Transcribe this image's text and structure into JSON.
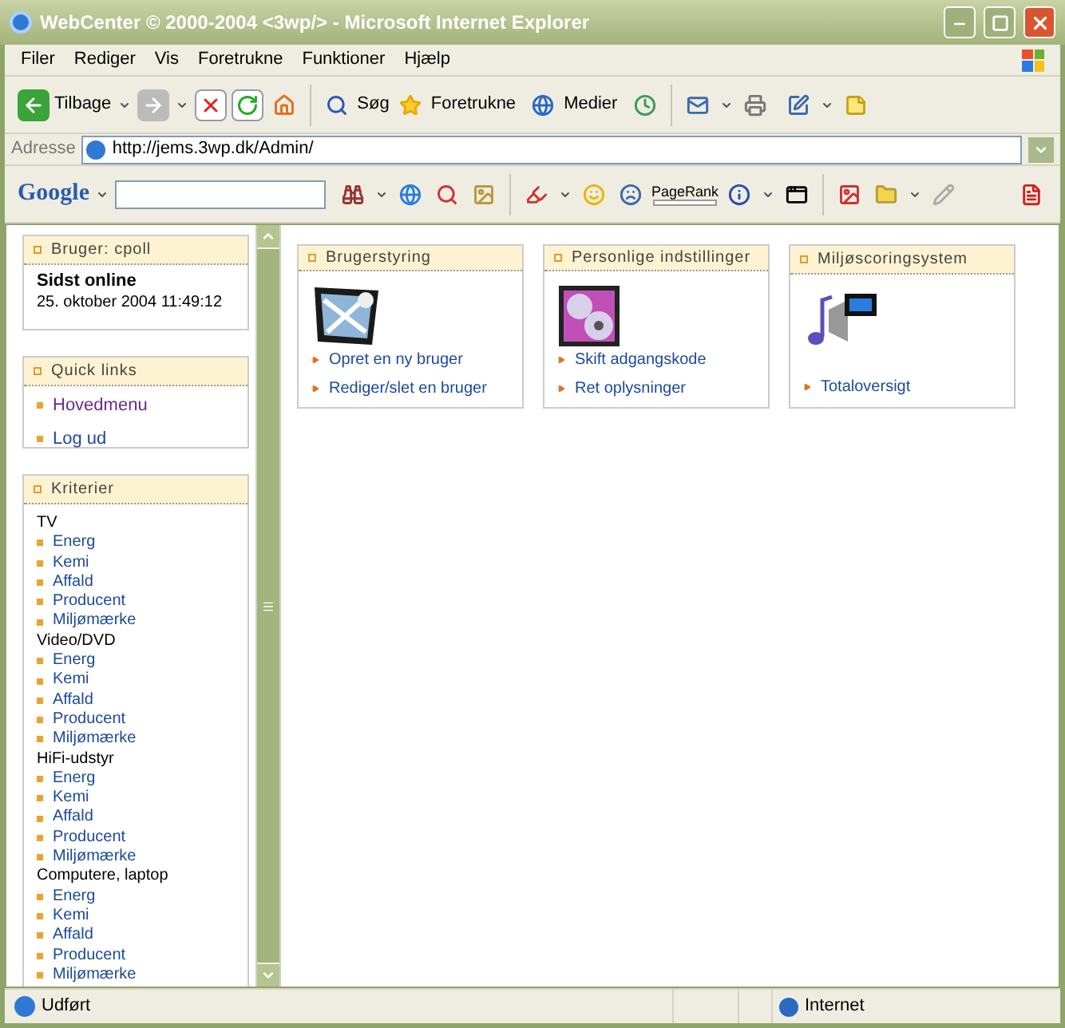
{
  "window": {
    "title": "WebCenter © 2000-2004 <3wp/> - Microsoft Internet Explorer"
  },
  "menu": [
    "Filer",
    "Rediger",
    "Vis",
    "Foretrukne",
    "Funktioner",
    "Hjælp"
  ],
  "toolbar": {
    "back": "Tilbage",
    "search": "Søg",
    "favorites": "Foretrukne",
    "media": "Medier"
  },
  "address": {
    "label": "Adresse",
    "value": "http://jems.3wp.dk/Admin/"
  },
  "google": {
    "logo": "Google",
    "pagerank": "PageRank"
  },
  "sidebar": {
    "user_panel": {
      "title": "Bruger: cpoll",
      "heading": "Sidst online",
      "text": "25. oktober 2004 11:49:12"
    },
    "quick_links": {
      "title": "Quick links",
      "items": [
        {
          "label": "Hovedmenu",
          "visited": true
        },
        {
          "label": "Log ud",
          "visited": false
        }
      ]
    },
    "criteria": {
      "title": "Kriterier",
      "groups": [
        {
          "label": "TV",
          "children": [
            "Energ",
            "Kemi",
            "Affald",
            "Producent",
            "Miljømærke"
          ]
        },
        {
          "label": "Video/DVD",
          "children": [
            "Energ",
            "Kemi",
            "Affald",
            "Producent",
            "Miljømærke"
          ]
        },
        {
          "label": "HiFi-udstyr",
          "children": [
            "Energ",
            "Kemi",
            "Affald",
            "Producent",
            "Miljømærke"
          ]
        },
        {
          "label": "Computere, laptop",
          "children": [
            "Energ",
            "Kemi",
            "Affald",
            "Producent",
            "Miljømærke"
          ]
        }
      ]
    }
  },
  "panels": [
    {
      "title": "Brugerstyring",
      "kind": "users",
      "links": [
        "Opret en ny bruger",
        "Rediger/slet en bruger"
      ]
    },
    {
      "title": "Personlige indstillinger",
      "kind": "settings",
      "links": [
        "Skift adgangskode",
        "Ret oplysninger"
      ]
    },
    {
      "title": "Miljøscoringsystem",
      "kind": "media",
      "links": [
        "Totaloversigt"
      ]
    }
  ],
  "status_bar": {
    "text": "Udført",
    "zone": "Internet"
  }
}
